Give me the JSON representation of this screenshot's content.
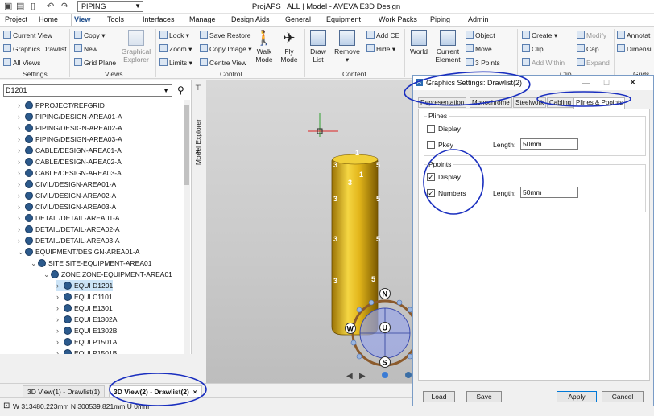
{
  "window": {
    "title": "ProjAPS | ALL | Model - AVEVA E3D Design",
    "module": "PIPING"
  },
  "menubar": [
    "Project",
    "Home",
    "View",
    "Tools",
    "Interfaces",
    "Manage",
    "Design Aids",
    "General",
    "Equipment",
    "Work Packs",
    "Piping",
    "Admin"
  ],
  "ribbon": {
    "settings": {
      "current_view": "Current View",
      "graphics_drawlist": "Graphics Drawlist",
      "all_views": "All Views",
      "group": "Settings"
    },
    "views": {
      "copy": "Copy",
      "new": "New",
      "grid_plane": "Grid Plane",
      "graphical_explorer_1": "Graphical",
      "graphical_explorer_2": "Explorer",
      "group": "Views"
    },
    "control": {
      "look": "Look",
      "zoom": "Zoom",
      "limits": "Limits",
      "save_restore": "Save  Restore",
      "copy_image": "Copy Image",
      "centre_view": "Centre View",
      "walk_mode_1": "Walk",
      "walk_mode_2": "Mode",
      "fly_mode_1": "Fly",
      "fly_mode_2": "Mode",
      "group": "Control"
    },
    "content": {
      "draw_list_1": "Draw",
      "draw_list_2": "List",
      "remove": "Remove",
      "add_ce": "Add CE",
      "hide": "Hide",
      "group": "Content"
    },
    "coordinate": {
      "world": "World",
      "current_element_1": "Current",
      "current_element_2": "Element",
      "object": "Object",
      "move": "Move",
      "three_points": "3 Points",
      "group": "Coordinate System"
    },
    "clip": {
      "create": "Create",
      "clip": "Clip",
      "add_within": "Add Within",
      "modify": "Modify",
      "cap": "Cap",
      "expand": "Expand",
      "group": "Clip"
    },
    "grids": {
      "annotation": "Annotat",
      "dimension": "Dimensi",
      "group": "Grids"
    }
  },
  "explorer": {
    "search_value": "D1201",
    "side_tab": "Model Explorer",
    "tree": [
      {
        "label": "PPROJECT/REFGRID",
        "level": 0,
        "expanded": false
      },
      {
        "label": "PIPING/DESIGN-AREA01-A",
        "level": 0,
        "expanded": false
      },
      {
        "label": "PIPING/DESIGN-AREA02-A",
        "level": 0,
        "expanded": false
      },
      {
        "label": "PIPING/DESIGN-AREA03-A",
        "level": 0,
        "expanded": false
      },
      {
        "label": "CABLE/DESIGN-AREA01-A",
        "level": 0,
        "expanded": false
      },
      {
        "label": "CABLE/DESIGN-AREA02-A",
        "level": 0,
        "expanded": false
      },
      {
        "label": "CABLE/DESIGN-AREA03-A",
        "level": 0,
        "expanded": false
      },
      {
        "label": "CIVIL/DESIGN-AREA01-A",
        "level": 0,
        "expanded": false
      },
      {
        "label": "CIVIL/DESIGN-AREA02-A",
        "level": 0,
        "expanded": false
      },
      {
        "label": "CIVIL/DESIGN-AREA03-A",
        "level": 0,
        "expanded": false
      },
      {
        "label": "DETAIL/DETAIL-AREA01-A",
        "level": 0,
        "expanded": false
      },
      {
        "label": "DETAIL/DETAIL-AREA02-A",
        "level": 0,
        "expanded": false
      },
      {
        "label": "DETAIL/DETAIL-AREA03-A",
        "level": 0,
        "expanded": false
      },
      {
        "label": "EQUIPMENT/DESIGN-AREA01-A",
        "level": 0,
        "expanded": true
      },
      {
        "label": "SITE SITE-EQUIPMENT-AREA01",
        "level": 1,
        "expanded": true
      },
      {
        "label": "ZONE ZONE-EQUIPMENT-AREA01",
        "level": 2,
        "expanded": true
      },
      {
        "label": "EQUI D1201",
        "level": 3,
        "expanded": false,
        "selected": true
      },
      {
        "label": "EQUI C1101",
        "level": 3,
        "expanded": false
      },
      {
        "label": "EQUI E1301",
        "level": 3,
        "expanded": false
      },
      {
        "label": "EQUI E1302A",
        "level": 3,
        "expanded": false
      },
      {
        "label": "EQUI E1302B",
        "level": 3,
        "expanded": false
      },
      {
        "label": "EQUI P1501A",
        "level": 3,
        "expanded": false
      },
      {
        "label": "EQUI P1501B",
        "level": 3,
        "expanded": false
      }
    ]
  },
  "viewport": {
    "labels": [
      "1",
      "3",
      "5",
      "5",
      "3",
      "5",
      "3",
      "3",
      "3",
      "1",
      "5",
      "N",
      "W",
      "U",
      "E",
      "S"
    ]
  },
  "view_tabs": [
    {
      "label": "3D View(1) - Drawlist(1)",
      "active": false
    },
    {
      "label": "3D View(2) - Drawlist(2)",
      "active": true,
      "close": "×"
    }
  ],
  "status": "W 313480.223mm N 300539.821mm U 0mm",
  "dialog": {
    "title": "Graphics Settings: Drawlist(2)",
    "tabs": [
      "Representation",
      "Monochrome",
      "Steelwork",
      "Cabling",
      "Plines & Ppoints"
    ],
    "active_tab": "Plines & Ppoints",
    "plines": {
      "legend": "Plines",
      "display": "Display",
      "display_checked": false,
      "pkey": "Pkey",
      "pkey_checked": false,
      "length_label": "Length:",
      "length_value": "50mm"
    },
    "ppoints": {
      "legend": "Ppoints",
      "display": "Display",
      "display_checked": true,
      "numbers": "Numbers",
      "numbers_checked": true,
      "length_label": "Length:",
      "length_value": "50mm"
    },
    "buttons": {
      "load": "Load",
      "save": "Save",
      "apply": "Apply",
      "cancel": "Cancel"
    }
  },
  "colors": {
    "annotation": "#1a2fbf",
    "vessel": "#e2b51a",
    "accent": "#1f4e8c"
  }
}
